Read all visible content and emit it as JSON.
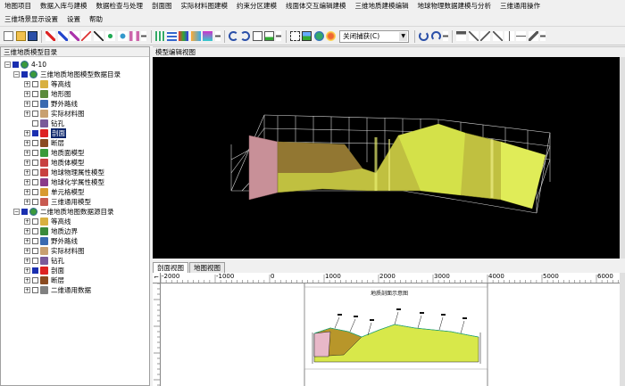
{
  "menu_row1": [
    "地图项目",
    "数据入库与建模",
    "数据检查与处理",
    "剖面图",
    "实际材料图建模",
    "约束分区建模",
    "线面体交互编辑建模",
    "三维地质建模编辑",
    "地球物理数据建模与分析",
    "三维通用操作"
  ],
  "menu_row2": [
    "三维场景显示设置",
    "设置",
    "帮助"
  ],
  "toolbar": {
    "combo_value": "关闭捕获(C)"
  },
  "left_panel": {
    "title": "三维地质模型目录",
    "root": "4-10",
    "group1": "三维地质地图模型数据目录",
    "group1_items": [
      "等高线",
      "地形图",
      "野外路线",
      "实际材料图",
      "钻孔",
      "剖面",
      "断层",
      "地质面模型",
      "地质体模型",
      "地球物理属性模型",
      "地球化学属性模型",
      "单元格模型",
      "三维通用模型"
    ],
    "group2": "二维地质地图数据源目录",
    "group2_items": [
      "等高线",
      "地质边界",
      "野外路线",
      "实际材料图",
      "钻孔",
      "剖面",
      "断层",
      "二维通用数据"
    ]
  },
  "right_panel": {
    "model_view_title": "模型编辑视图",
    "tabs": [
      "剖面视图",
      "地图视图"
    ],
    "ruler_ticks": [
      "-2000",
      "-1000",
      "0",
      "1000",
      "2000",
      "3000",
      "4000",
      "5000",
      "6000"
    ],
    "section_title": "地质剖面示意图"
  },
  "colors": {
    "selected": "#0a246a",
    "scene_bg": "#000000",
    "geo_yellow": "#d8e84a",
    "geo_brown": "#b8962a",
    "geo_pink": "#e8b8c8"
  }
}
